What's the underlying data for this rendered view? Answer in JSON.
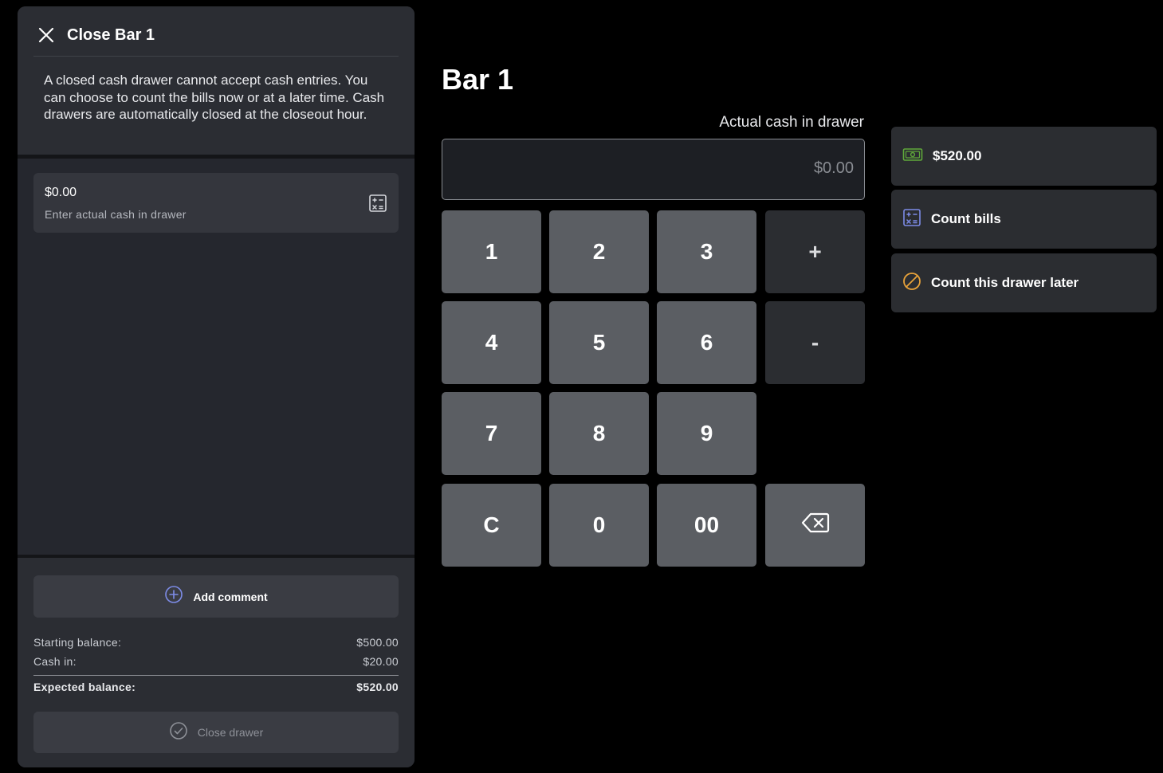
{
  "panel": {
    "title": "Close Bar 1",
    "description": "A closed cash drawer cannot accept cash entries. You can choose to count the bills now or at a later time. Cash drawers are automatically closed at the closeout hour.",
    "cash_field": {
      "value": "$0.00",
      "hint": "Enter actual cash in drawer"
    },
    "add_comment_label": "Add comment",
    "balances": {
      "starting_label": "Starting balance:",
      "starting_value": "$500.00",
      "cash_in_label": "Cash in:",
      "cash_in_value": "$20.00",
      "expected_label": "Expected balance:",
      "expected_value": "$520.00"
    },
    "close_drawer_label": "Close drawer"
  },
  "main": {
    "title": "Bar 1",
    "actual_cash_label": "Actual cash in drawer",
    "display_value": "$0.00",
    "keys": {
      "k1": "1",
      "k2": "2",
      "k3": "3",
      "plus": "+",
      "k4": "4",
      "k5": "5",
      "k6": "6",
      "minus": "-",
      "k7": "7",
      "k8": "8",
      "k9": "9",
      "clear": "C",
      "k0": "0",
      "k00": "00"
    }
  },
  "side": {
    "amount_label": "$520.00",
    "count_bills_label": "Count bills",
    "count_later_label": "Count this drawer later"
  },
  "icons": {
    "close": "close-icon",
    "calculator": "calculator-icon",
    "add": "plus-circle-icon",
    "check": "check-circle-icon",
    "backspace": "backspace-icon",
    "cash": "cash-icon",
    "later": "slash-circle-icon"
  },
  "colors": {
    "cash_icon": "#5fa83a",
    "count_bills_icon": "#7d8ce8",
    "count_later_icon": "#e7a23a",
    "add_icon": "#7d8ce8"
  }
}
